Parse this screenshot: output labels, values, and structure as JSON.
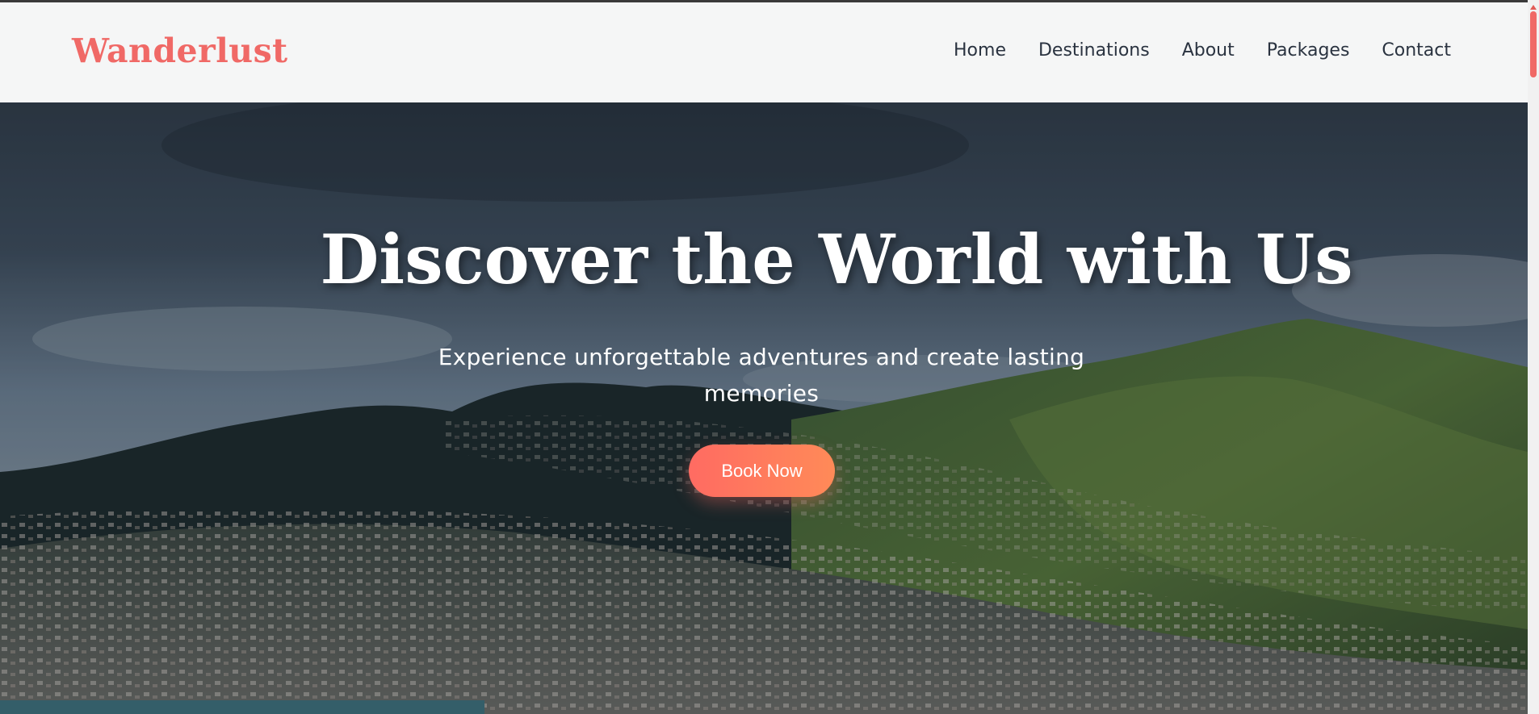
{
  "brand": {
    "name": "Wanderlust",
    "color": "#f06966"
  },
  "nav": {
    "links": [
      {
        "label": "Home"
      },
      {
        "label": "Destinations"
      },
      {
        "label": "About"
      },
      {
        "label": "Packages"
      },
      {
        "label": "Contact"
      }
    ]
  },
  "hero": {
    "title": "Discover the World with Us",
    "subtitle": "Experience unforgettable adventures and create lasting memories",
    "cta_label": "Book Now",
    "cta_colors": [
      "#ff6b62",
      "#ff8a58"
    ],
    "background": "mountain-town-landscape-image"
  },
  "scrollbar": {
    "thumb_color": "#f06966"
  }
}
